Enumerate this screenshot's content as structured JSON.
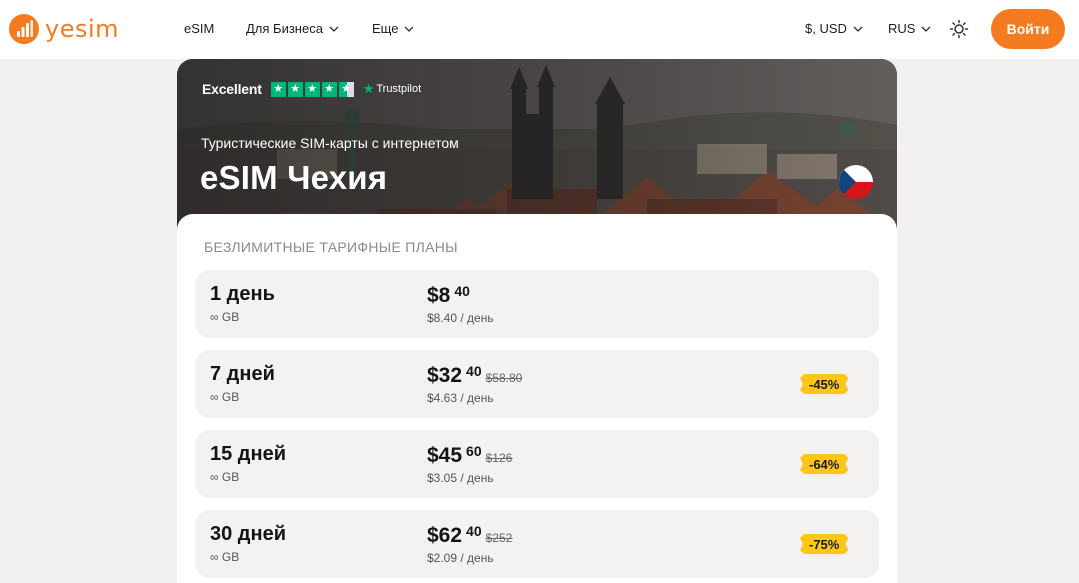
{
  "header": {
    "logo_text": "yesim",
    "nav": [
      {
        "label": "eSIM",
        "has_dropdown": false
      },
      {
        "label": "Для Бизнеса",
        "has_dropdown": true
      },
      {
        "label": "Еще",
        "has_dropdown": true
      }
    ],
    "currency": "$, USD",
    "language": "RUS",
    "theme_icon": "sun-icon",
    "login_label": "Войти",
    "accent_color": "#f47b20"
  },
  "hero": {
    "rating_label": "Excellent",
    "rating_stars": 4.5,
    "rating_brand": "Trustpilot",
    "subtitle": "Туристические SIM-карты с интернетом",
    "title": "eSIM Чехия",
    "flag": "czech-flag-icon"
  },
  "plans_section": {
    "title": "БЕЗЛИМИТНЫЕ ТАРИФНЫЕ ПЛАНЫ",
    "plans": [
      {
        "name": "1 день",
        "data": "∞ GB",
        "price_main": "$8",
        "price_cents": "40",
        "old_price": "",
        "per_day": "$8.40 / день",
        "discount": ""
      },
      {
        "name": "7 дней",
        "data": "∞ GB",
        "price_main": "$32",
        "price_cents": "40",
        "old_price": "$58.80",
        "per_day": "$4.63 / день",
        "discount": "-45%"
      },
      {
        "name": "15 дней",
        "data": "∞ GB",
        "price_main": "$45",
        "price_cents": "60",
        "old_price": "$126",
        "per_day": "$3.05 / день",
        "discount": "-64%"
      },
      {
        "name": "30 дней",
        "data": "∞ GB",
        "price_main": "$62",
        "price_cents": "40",
        "old_price": "$252",
        "per_day": "$2.09 / день",
        "discount": "-75%"
      }
    ]
  }
}
